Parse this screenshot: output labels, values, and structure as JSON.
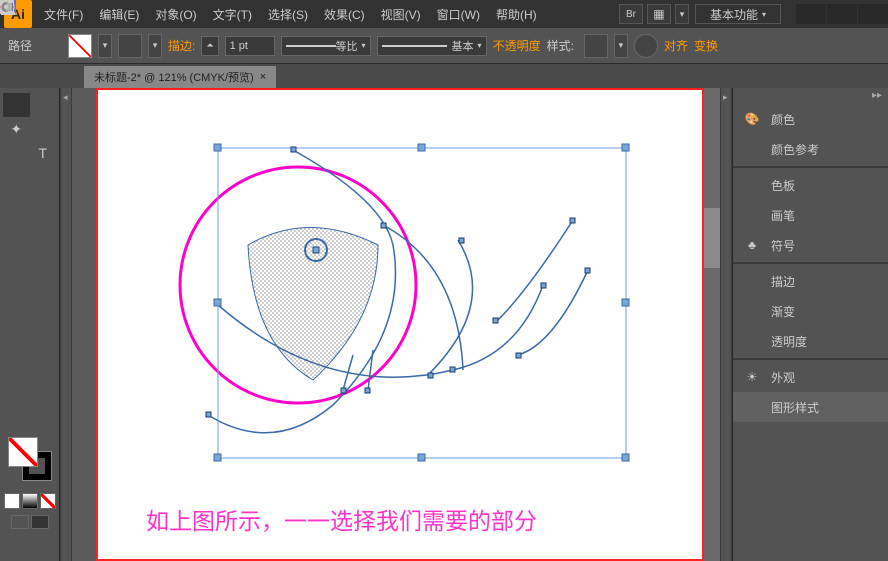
{
  "app": {
    "icon_text": "Ai"
  },
  "menus": [
    {
      "label": "文件(F)"
    },
    {
      "label": "编辑(E)"
    },
    {
      "label": "对象(O)"
    },
    {
      "label": "文字(T)"
    },
    {
      "label": "选择(S)"
    },
    {
      "label": "效果(C)"
    },
    {
      "label": "视图(V)"
    },
    {
      "label": "窗口(W)"
    },
    {
      "label": "帮助(H)"
    }
  ],
  "workspace": "基本功能",
  "controlbar": {
    "path_label": "路径",
    "stroke_label": "描边:",
    "stroke_weight": "1 pt",
    "profile_label": "等比",
    "brush_label": "基本",
    "opacity_label": "不透明度",
    "style_label": "样式:",
    "align_label": "对齐",
    "transform_label": "变换"
  },
  "tab": {
    "title": "未标题-2* @ 121% (CMYK/预览)"
  },
  "panels": [
    {
      "icon": "palette",
      "label": "颜色"
    },
    {
      "icon": "swatches-ref",
      "label": "颜色参考"
    },
    {
      "divider": true
    },
    {
      "icon": "grid",
      "label": "色板"
    },
    {
      "icon": "brush",
      "label": "画笔"
    },
    {
      "icon": "club",
      "label": "符号"
    },
    {
      "divider": true
    },
    {
      "icon": "lines",
      "label": "描边"
    },
    {
      "icon": "gradient",
      "label": "渐变"
    },
    {
      "icon": "circles",
      "label": "透明度"
    },
    {
      "divider": true
    },
    {
      "icon": "sun",
      "label": "外观"
    },
    {
      "icon": "doc",
      "label": "图形样式"
    }
  ],
  "caption": "如上图所示，一一选择我们需要的部分"
}
